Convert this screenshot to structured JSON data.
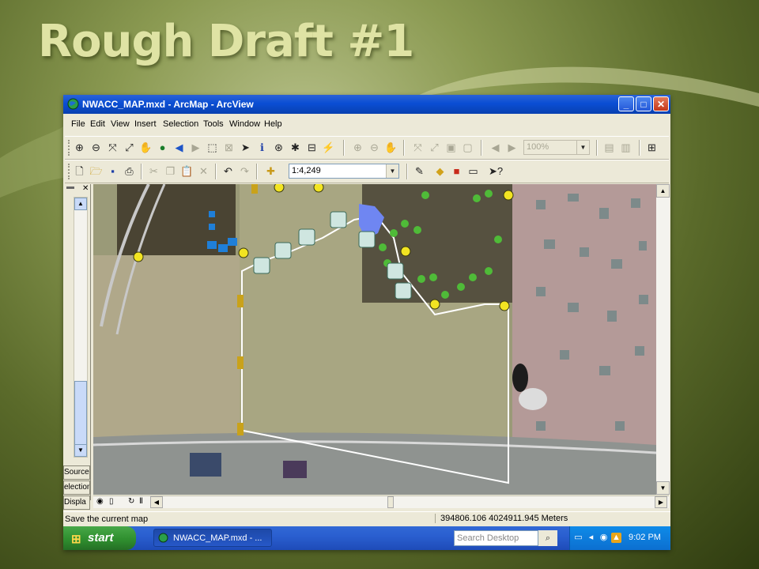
{
  "slide": {
    "title": "Rough Draft #1"
  },
  "window": {
    "title": "NWACC_MAP.mxd - ArcMap - ArcView",
    "buttons": {
      "minimize": "_",
      "maximize": "□",
      "close": "✕"
    }
  },
  "menu": [
    "File",
    "Edit",
    "View",
    "Insert",
    "Selection",
    "Tools",
    "Window",
    "Help"
  ],
  "toolbar": {
    "zoom_percent": "100%",
    "scale": "1:4,249"
  },
  "toc": {
    "tabs": [
      "Source",
      "election",
      "Displa"
    ]
  },
  "statusbar": {
    "message": "Save the current map",
    "coordinates": "394806.106  4024911.945 Meters"
  },
  "taskbar": {
    "start_label": "start",
    "task_label": "NWACC_MAP.mxd - ...",
    "search_placeholder": "Search Desktop",
    "clock": "9:02 PM"
  },
  "colors": {
    "titlebar": "#0a4ed4",
    "route_line": "#ffffff",
    "pond": "#6f86f2",
    "marker_yellow": "#f2e422",
    "marker_tree": "#4fbb38"
  }
}
